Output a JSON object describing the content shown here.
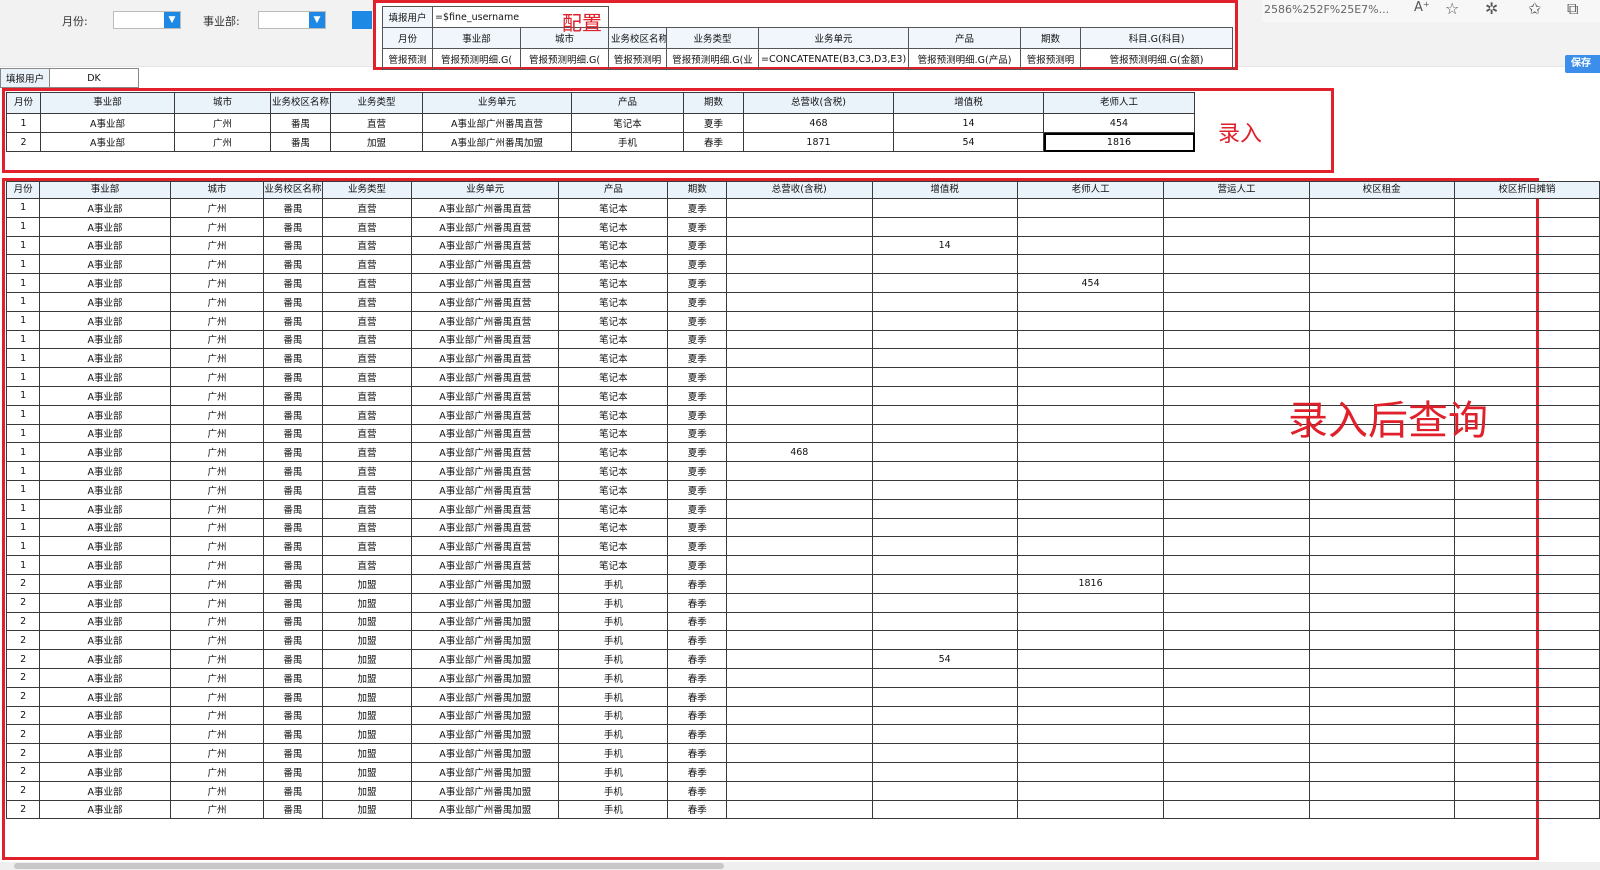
{
  "filters": {
    "month_label": "月份:",
    "division_label": "事业部:",
    "month_value": "",
    "division_value": ""
  },
  "browser": {
    "url_fragment": "2586%252F%25E7%...",
    "save_label": "保存"
  },
  "config": {
    "label": "配置",
    "user_label": "填报用户",
    "user_formula": "=$fine_username",
    "headers": [
      "月份",
      "事业部",
      "城市",
      "业务校区名称",
      "业务类型",
      "业务单元",
      "产品",
      "期数",
      "科目.G(科目)"
    ],
    "formulas": [
      "管报预测",
      "管报预测明细.G(",
      "管报预测明细.G(",
      "管报预测明",
      "管报预测明细.G(业",
      "=CONCATENATE(B3,C3,D3,E3)",
      "管报预测明细.G(产品)",
      "管报预测明",
      "管报预测明细.G(金额)"
    ]
  },
  "fill_user": {
    "label": "填报用户",
    "value": "DK"
  },
  "entry": {
    "label": "录入",
    "headers": [
      "月份",
      "事业部",
      "城市",
      "业务校区名称",
      "业务类型",
      "业务单元",
      "产品",
      "期数",
      "总营收(含税)",
      "增值税",
      "老师人工"
    ],
    "rows": [
      [
        "1",
        "A事业部",
        "广州",
        "番禺",
        "直营",
        "A事业部广州番禺直营",
        "笔记本",
        "夏季",
        "468",
        "14",
        "454"
      ],
      [
        "2",
        "A事业部",
        "广州",
        "番禺",
        "加盟",
        "A事业部广州番禺加盟",
        "手机",
        "春季",
        "1871",
        "54",
        "1816"
      ]
    ]
  },
  "query": {
    "label": "录入后查询",
    "headers": [
      "月份",
      "事业部",
      "城市",
      "业务校区名称",
      "业务类型",
      "业务单元",
      "产品",
      "期数",
      "总营收(含税)",
      "增值税",
      "老师人工",
      "营运人工",
      "校区租金",
      "校区折旧摊销"
    ],
    "rows": [
      [
        "1",
        "A事业部",
        "广州",
        "番禺",
        "直营",
        "A事业部广州番禺直营",
        "笔记本",
        "夏季",
        "",
        "",
        "",
        "",
        "",
        ""
      ],
      [
        "1",
        "A事业部",
        "广州",
        "番禺",
        "直营",
        "A事业部广州番禺直营",
        "笔记本",
        "夏季",
        "",
        "",
        "",
        "",
        "",
        ""
      ],
      [
        "1",
        "A事业部",
        "广州",
        "番禺",
        "直营",
        "A事业部广州番禺直营",
        "笔记本",
        "夏季",
        "",
        "14",
        "",
        "",
        "",
        ""
      ],
      [
        "1",
        "A事业部",
        "广州",
        "番禺",
        "直营",
        "A事业部广州番禺直营",
        "笔记本",
        "夏季",
        "",
        "",
        "",
        "",
        "",
        ""
      ],
      [
        "1",
        "A事业部",
        "广州",
        "番禺",
        "直营",
        "A事业部广州番禺直营",
        "笔记本",
        "夏季",
        "",
        "",
        "454",
        "",
        "",
        ""
      ],
      [
        "1",
        "A事业部",
        "广州",
        "番禺",
        "直营",
        "A事业部广州番禺直营",
        "笔记本",
        "夏季",
        "",
        "",
        "",
        "",
        "",
        ""
      ],
      [
        "1",
        "A事业部",
        "广州",
        "番禺",
        "直营",
        "A事业部广州番禺直营",
        "笔记本",
        "夏季",
        "",
        "",
        "",
        "",
        "",
        ""
      ],
      [
        "1",
        "A事业部",
        "广州",
        "番禺",
        "直营",
        "A事业部广州番禺直营",
        "笔记本",
        "夏季",
        "",
        "",
        "",
        "",
        "",
        ""
      ],
      [
        "1",
        "A事业部",
        "广州",
        "番禺",
        "直营",
        "A事业部广州番禺直营",
        "笔记本",
        "夏季",
        "",
        "",
        "",
        "",
        "",
        ""
      ],
      [
        "1",
        "A事业部",
        "广州",
        "番禺",
        "直营",
        "A事业部广州番禺直营",
        "笔记本",
        "夏季",
        "",
        "",
        "",
        "",
        "",
        ""
      ],
      [
        "1",
        "A事业部",
        "广州",
        "番禺",
        "直营",
        "A事业部广州番禺直营",
        "笔记本",
        "夏季",
        "",
        "",
        "",
        "",
        "",
        ""
      ],
      [
        "1",
        "A事业部",
        "广州",
        "番禺",
        "直营",
        "A事业部广州番禺直营",
        "笔记本",
        "夏季",
        "",
        "",
        "",
        "",
        "",
        ""
      ],
      [
        "1",
        "A事业部",
        "广州",
        "番禺",
        "直营",
        "A事业部广州番禺直营",
        "笔记本",
        "夏季",
        "",
        "",
        "",
        "",
        "",
        ""
      ],
      [
        "1",
        "A事业部",
        "广州",
        "番禺",
        "直营",
        "A事业部广州番禺直营",
        "笔记本",
        "夏季",
        "468",
        "",
        "",
        "",
        "",
        ""
      ],
      [
        "1",
        "A事业部",
        "广州",
        "番禺",
        "直营",
        "A事业部广州番禺直营",
        "笔记本",
        "夏季",
        "",
        "",
        "",
        "",
        "",
        ""
      ],
      [
        "1",
        "A事业部",
        "广州",
        "番禺",
        "直营",
        "A事业部广州番禺直营",
        "笔记本",
        "夏季",
        "",
        "",
        "",
        "",
        "",
        ""
      ],
      [
        "1",
        "A事业部",
        "广州",
        "番禺",
        "直营",
        "A事业部广州番禺直营",
        "笔记本",
        "夏季",
        "",
        "",
        "",
        "",
        "",
        ""
      ],
      [
        "1",
        "A事业部",
        "广州",
        "番禺",
        "直营",
        "A事业部广州番禺直营",
        "笔记本",
        "夏季",
        "",
        "",
        "",
        "",
        "",
        ""
      ],
      [
        "1",
        "A事业部",
        "广州",
        "番禺",
        "直营",
        "A事业部广州番禺直营",
        "笔记本",
        "夏季",
        "",
        "",
        "",
        "",
        "",
        ""
      ],
      [
        "1",
        "A事业部",
        "广州",
        "番禺",
        "直营",
        "A事业部广州番禺直营",
        "笔记本",
        "夏季",
        "",
        "",
        "",
        "",
        "",
        ""
      ],
      [
        "2",
        "A事业部",
        "广州",
        "番禺",
        "加盟",
        "A事业部广州番禺加盟",
        "手机",
        "春季",
        "",
        "",
        "1816",
        "",
        "",
        ""
      ],
      [
        "2",
        "A事业部",
        "广州",
        "番禺",
        "加盟",
        "A事业部广州番禺加盟",
        "手机",
        "春季",
        "",
        "",
        "",
        "",
        "",
        ""
      ],
      [
        "2",
        "A事业部",
        "广州",
        "番禺",
        "加盟",
        "A事业部广州番禺加盟",
        "手机",
        "春季",
        "",
        "",
        "",
        "",
        "",
        ""
      ],
      [
        "2",
        "A事业部",
        "广州",
        "番禺",
        "加盟",
        "A事业部广州番禺加盟",
        "手机",
        "春季",
        "",
        "",
        "",
        "",
        "",
        ""
      ],
      [
        "2",
        "A事业部",
        "广州",
        "番禺",
        "加盟",
        "A事业部广州番禺加盟",
        "手机",
        "春季",
        "",
        "54",
        "",
        "",
        "",
        ""
      ],
      [
        "2",
        "A事业部",
        "广州",
        "番禺",
        "加盟",
        "A事业部广州番禺加盟",
        "手机",
        "春季",
        "",
        "",
        "",
        "",
        "",
        ""
      ],
      [
        "2",
        "A事业部",
        "广州",
        "番禺",
        "加盟",
        "A事业部广州番禺加盟",
        "手机",
        "春季",
        "",
        "",
        "",
        "",
        "",
        ""
      ],
      [
        "2",
        "A事业部",
        "广州",
        "番禺",
        "加盟",
        "A事业部广州番禺加盟",
        "手机",
        "春季",
        "",
        "",
        "",
        "",
        "",
        ""
      ],
      [
        "2",
        "A事业部",
        "广州",
        "番禺",
        "加盟",
        "A事业部广州番禺加盟",
        "手机",
        "春季",
        "",
        "",
        "",
        "",
        "",
        ""
      ],
      [
        "2",
        "A事业部",
        "广州",
        "番禺",
        "加盟",
        "A事业部广州番禺加盟",
        "手机",
        "春季",
        "",
        "",
        "",
        "",
        "",
        ""
      ],
      [
        "2",
        "A事业部",
        "广州",
        "番禺",
        "加盟",
        "A事业部广州番禺加盟",
        "手机",
        "春季",
        "",
        "",
        "",
        "",
        "",
        ""
      ],
      [
        "2",
        "A事业部",
        "广州",
        "番禺",
        "加盟",
        "A事业部广州番禺加盟",
        "手机",
        "春季",
        "",
        "",
        "",
        "",
        "",
        ""
      ],
      [
        "2",
        "A事业部",
        "广州",
        "番禺",
        "加盟",
        "A事业部广州番禺加盟",
        "手机",
        "春季",
        "",
        "",
        "",
        "",
        "",
        ""
      ]
    ]
  },
  "colors": {
    "accent_red": "#e0202a",
    "header_bg": "#eaf2fa",
    "save_blue": "#3d8eea"
  }
}
